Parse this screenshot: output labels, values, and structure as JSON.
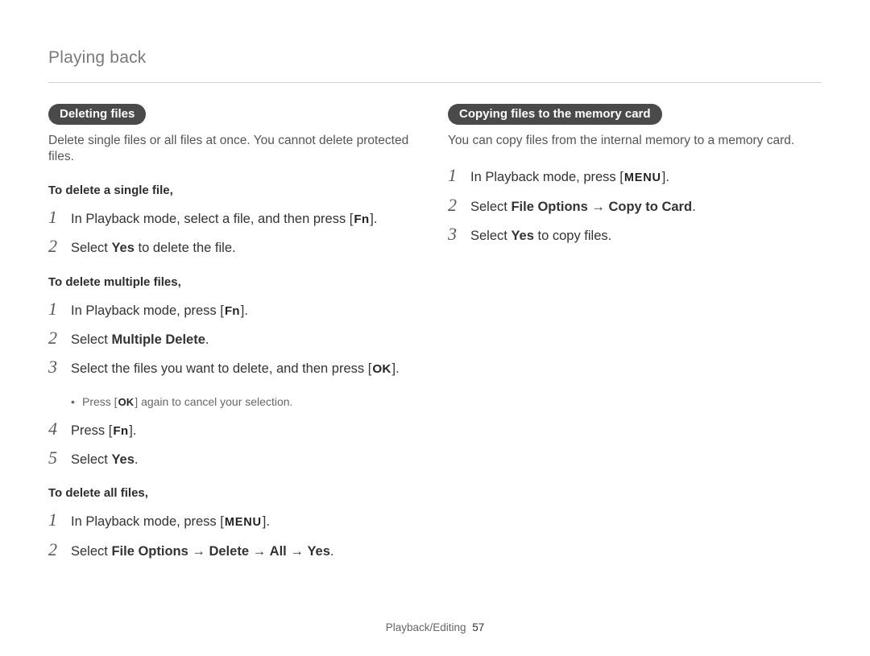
{
  "page": {
    "header": "Playing back",
    "footer_section": "Playback/Editing",
    "footer_page": "57"
  },
  "buttons": {
    "fn": "Fn",
    "ok": "OK",
    "menu": "MENU"
  },
  "left": {
    "pill": "Deleting files",
    "intro": "Delete single files or all files at once. You cannot delete protected files.",
    "single": {
      "heading": "To delete a single file,",
      "s1a": "In Playback mode, select a file, and then press [",
      "s1b": "].",
      "s2a": "Select ",
      "s2b": "Yes",
      "s2c": " to delete the file."
    },
    "multiple": {
      "heading": "To delete multiple files,",
      "s1a": "In Playback mode, press [",
      "s1b": "].",
      "s2a": "Select ",
      "s2b": "Multiple Delete",
      "s2c": ".",
      "s3a": "Select the files you want to delete, and then press [",
      "s3b": "].",
      "s3_bullet_a": "Press [",
      "s3_bullet_b": "] again to cancel your selection.",
      "s4a": "Press [",
      "s4b": "].",
      "s5a": "Select ",
      "s5b": "Yes",
      "s5c": "."
    },
    "all": {
      "heading": "To delete all files,",
      "s1a": "In Playback mode, press [",
      "s1b": "].",
      "s2a": "Select ",
      "s2b": "File Options",
      "s2c": " → ",
      "s2d": "Delete",
      "s2e": " → ",
      "s2f": "All",
      "s2g": " → ",
      "s2h": "Yes",
      "s2i": "."
    }
  },
  "right": {
    "pill": "Copying files to the memory card",
    "intro": "You can copy files from the internal memory to a memory card.",
    "s1a": "In Playback mode, press [",
    "s1b": "].",
    "s2a": "Select ",
    "s2b": "File Options",
    "s2c": " → ",
    "s2d": "Copy to Card",
    "s2e": ".",
    "s3a": "Select ",
    "s3b": "Yes",
    "s3c": " to copy files."
  },
  "nums": {
    "n1": "1",
    "n2": "2",
    "n3": "3",
    "n4": "4",
    "n5": "5"
  }
}
